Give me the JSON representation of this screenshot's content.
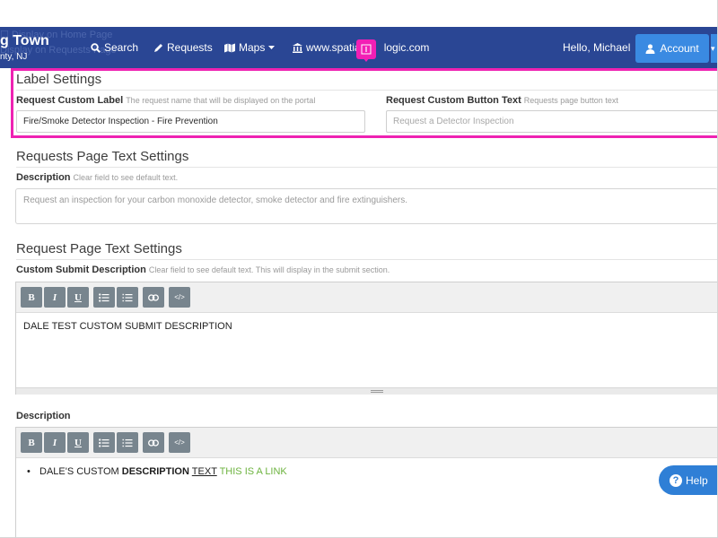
{
  "navbar": {
    "ghost_home": "☐ Display on Home Page",
    "ghost_requests": "Display on Requests Page",
    "brand_title": "g Town",
    "brand_subtitle": "nty, NJ",
    "search_label": "Search",
    "requests_label": "Requests",
    "maps_label": "Maps",
    "website_label": "www.spatia",
    "website_label_tail": "logic.com",
    "greeting": "Hello, Michael",
    "account_label": "Account",
    "pink_tab_icon": "info-icon"
  },
  "label_settings": {
    "title": "Label Settings",
    "custom_label": {
      "label": "Request Custom Label",
      "hint": "The request name that will be displayed on the portal",
      "value": "Fire/Smoke Detector Inspection - Fire Prevention"
    },
    "button_text": {
      "label": "Request Custom Button Text",
      "hint": "Requests page button text",
      "placeholder": "Request a Detector Inspection"
    }
  },
  "requests_page": {
    "title": "Requests Page Text Settings",
    "description_label": "Description",
    "description_hint": "Clear field to see default text.",
    "description_placeholder": "Request an inspection for your carbon monoxide detector, smoke detector and fire extinguishers."
  },
  "request_page": {
    "title": "Request Page Text Settings",
    "submit_label": "Custom Submit Description",
    "submit_hint": "Clear field to see default text. This will display in the submit section.",
    "submit_text": "DALE TEST CUSTOM SUBMIT DESCRIPTION",
    "description_label": "Description",
    "bullet_plain": "DALE'S CUSTOM ",
    "bullet_bold": "DESCRIPTION",
    "bullet_underline": "TEXT",
    "bullet_link": "THIS IS A LINK"
  },
  "toolbar": {
    "bold": "B",
    "italic": "I",
    "underline": "U",
    "code": "</>"
  },
  "help": {
    "label": "Help",
    "glyph": "?"
  },
  "colors": {
    "navbar": "#2a4694",
    "accent": "#3a8ae2",
    "highlight": "#ee22b2",
    "link": "#6db33f"
  }
}
